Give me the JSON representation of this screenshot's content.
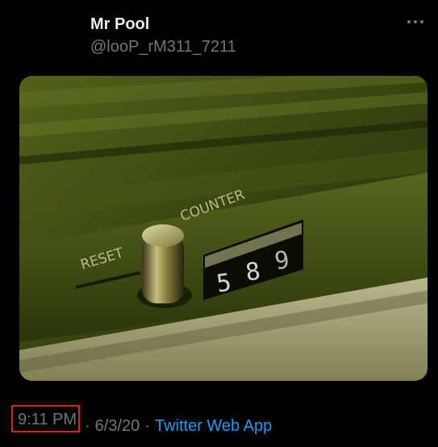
{
  "user": {
    "display_name": "Mr Pool",
    "handle": "@looP_rM311_7211"
  },
  "media": {
    "reset_label": "RESET",
    "counter_label": "COUNTER",
    "digits": [
      "5",
      "8",
      "9"
    ]
  },
  "meta": {
    "time": "9:11 PM",
    "separator": "·",
    "date": "6/3/20",
    "source": "Twitter Web App"
  },
  "colors": {
    "accent": "#1d9bf0",
    "highlight": "#e0201c"
  },
  "icons": {
    "more": "more-horizontal-icon"
  }
}
